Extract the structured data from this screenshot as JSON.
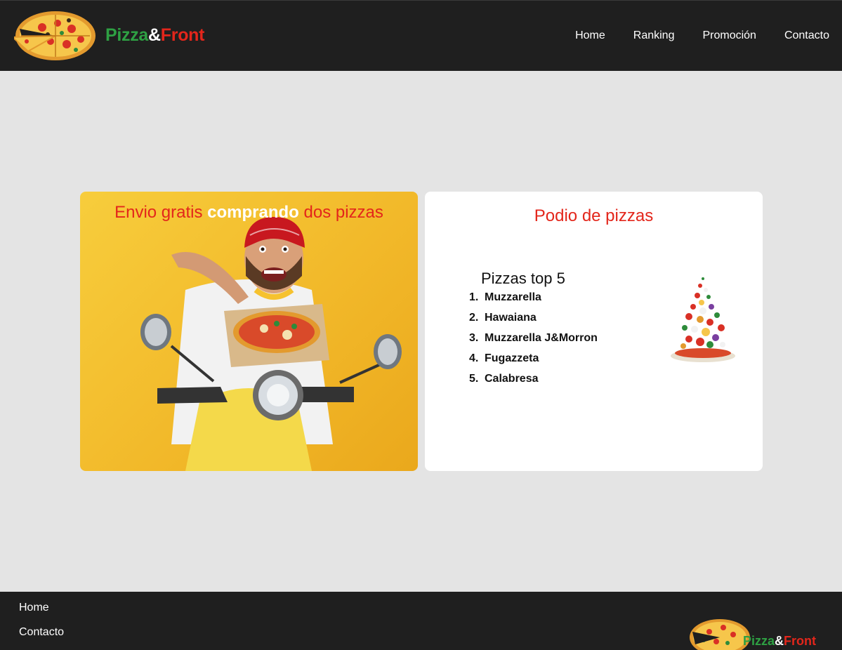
{
  "header": {
    "brand": {
      "pizza": "Pizza",
      "amp": "&",
      "front": "Front"
    },
    "nav": [
      "Home",
      "Ranking",
      "Promoción",
      "Contacto"
    ]
  },
  "promo": {
    "title_part1": "Envio gratis",
    "title_part2": "comprando",
    "title_part3": "dos pizzas"
  },
  "podium": {
    "title": "Podio de pizzas",
    "heading": "Pizzas top 5",
    "items": [
      {
        "num": "1.",
        "label": "Muzzarella"
      },
      {
        "num": "2.",
        "label": "Hawaiana"
      },
      {
        "num": "3.",
        "label": "Muzzarella J&Morron"
      },
      {
        "num": "4.",
        "label": "Fugazzeta"
      },
      {
        "num": "5.",
        "label": "Calabresa"
      }
    ]
  },
  "footer": {
    "links": [
      "Home",
      "Contacto"
    ],
    "brand": {
      "pizza": "Pizza",
      "amp": "&",
      "front": "Front"
    }
  },
  "colors": {
    "header_bg": "#1f1f1f",
    "page_bg": "#e4e4e4",
    "accent_red": "#e3261b",
    "accent_green": "#2ea043",
    "promo_yellow": "#f2b92a"
  }
}
